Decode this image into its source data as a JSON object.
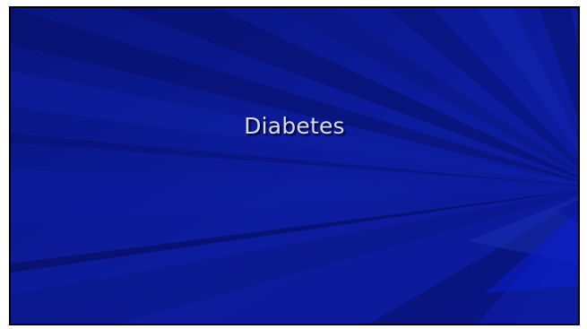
{
  "slide": {
    "title": "Diabetes",
    "background_color": "#0c1a9a",
    "title_color": "#d7dcf6"
  }
}
